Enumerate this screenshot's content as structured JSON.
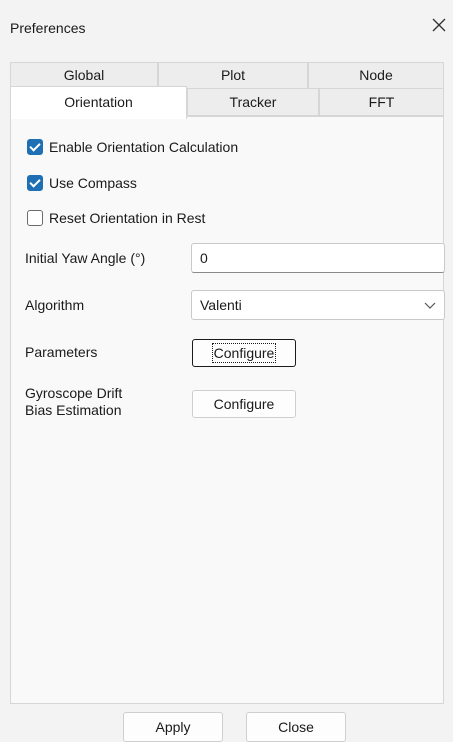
{
  "window": {
    "title": "Preferences"
  },
  "tabs": {
    "back_row": [
      "Global",
      "Plot",
      "Node"
    ],
    "front_row": [
      "Orientation",
      "Tracker",
      "FFT"
    ],
    "active": "Orientation"
  },
  "options": {
    "enable_orientation": {
      "label": "Enable Orientation Calculation",
      "checked": true
    },
    "use_compass": {
      "label": "Use Compass",
      "checked": true
    },
    "reset_in_rest": {
      "label": "Reset Orientation in Rest",
      "checked": false
    }
  },
  "fields": {
    "initial_yaw_label": "Initial Yaw Angle (°)",
    "initial_yaw_value": "0",
    "algorithm_label": "Algorithm",
    "algorithm_value": "Valenti",
    "parameters_label": "Parameters",
    "parameters_button": "Configure",
    "gyro_label_line1": "Gyroscope Drift",
    "gyro_label_line2": "Bias Estimation",
    "gyro_button": "Configure"
  },
  "footer": {
    "apply": "Apply",
    "close": "Close"
  },
  "colors": {
    "accent": "#1f6fb5",
    "background": "#f3f3f3"
  },
  "icons": {
    "close": "close-icon",
    "dropdown": "chevron-down-icon",
    "check": "check-icon"
  }
}
